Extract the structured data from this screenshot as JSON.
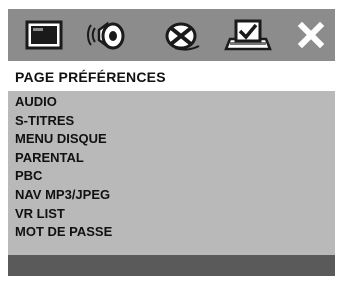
{
  "tabs": [
    {
      "icon": "screen-icon",
      "selected": false
    },
    {
      "icon": "speaker-icon",
      "selected": false
    },
    {
      "icon": "disc-icon",
      "selected": false
    },
    {
      "icon": "preferences-icon",
      "selected": true
    },
    {
      "icon": "close-icon",
      "selected": false
    }
  ],
  "page": {
    "title": "PAGE PRÉFÉRENCES"
  },
  "menu": {
    "items": [
      {
        "label": "AUDIO"
      },
      {
        "label": "S-TITRES"
      },
      {
        "label": "MENU DISQUE"
      },
      {
        "label": "PARENTAL"
      },
      {
        "label": "PBC"
      },
      {
        "label": "NAV MP3/JPEG"
      },
      {
        "label": "VR LIST"
      },
      {
        "label": "MOT DE PASSE"
      }
    ]
  },
  "colors": {
    "tab_bar": "#8c8c8c",
    "panel": "#b9b9b9",
    "header": "#ffffff",
    "footer": "#5a5a5a",
    "icon": "#1a1a1a"
  }
}
